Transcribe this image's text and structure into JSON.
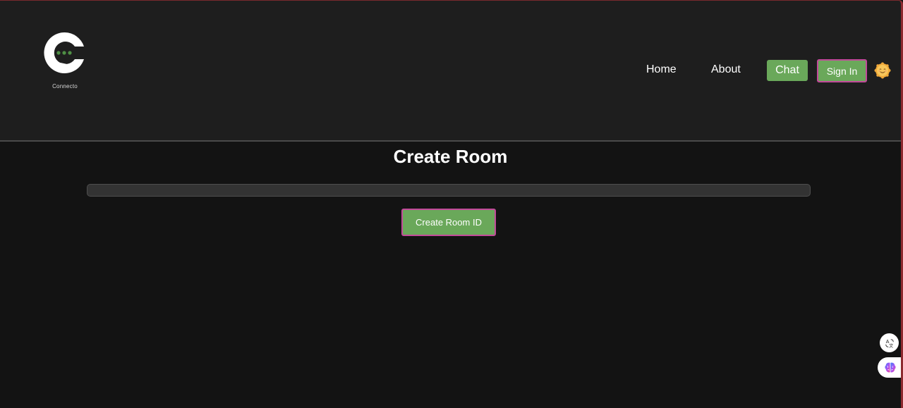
{
  "header": {
    "logo_text": "Connecto",
    "nav": {
      "home": "Home",
      "about": "About",
      "chat": "Chat",
      "sign_in": "Sign In"
    },
    "theme_icon": "sun-face-icon"
  },
  "main": {
    "title": "Create Room",
    "room_input": {
      "value": "",
      "placeholder": ""
    },
    "create_button": "Create Room ID"
  },
  "floating": {
    "translate_icon": "translate-icon",
    "brain_icon": "brain-icon"
  },
  "colors": {
    "accent_green": "#6aa85a",
    "accent_border_pink": "#c24a9a",
    "header_bg": "#1e1e1e",
    "page_bg": "#131313",
    "logo_dots": "#4f8f45"
  }
}
